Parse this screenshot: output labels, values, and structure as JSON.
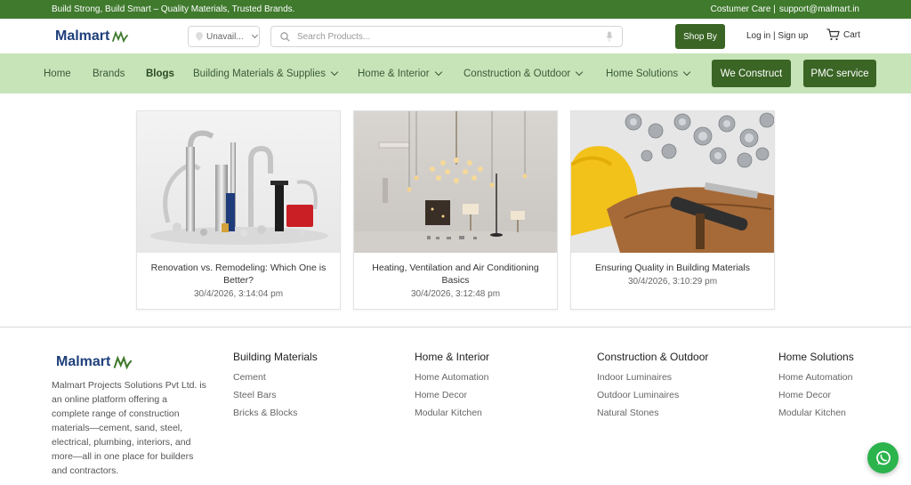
{
  "topbar": {
    "tagline": "Build Strong, Build Smart – Quality Materials, Trusted Brands.",
    "care_label": "Costumer Care |",
    "email": "support@malmart.in"
  },
  "header": {
    "logo_text": "Malmart",
    "location_value": "Unavail...",
    "search_placeholder": "Search Products...",
    "shopby_label": "Shop By",
    "auth_label": "Log in | Sign up",
    "cart_label": "Cart"
  },
  "nav": {
    "items": [
      {
        "label": "Home"
      },
      {
        "label": "Brands"
      },
      {
        "label": "Blogs"
      },
      {
        "label": "Building Materials & Supplies"
      },
      {
        "label": "Home & Interior"
      },
      {
        "label": "Construction & Outdoor"
      },
      {
        "label": "Home Solutions"
      }
    ],
    "buttons": [
      {
        "label": "We Construct"
      },
      {
        "label": "PMC service"
      }
    ]
  },
  "posts": [
    {
      "title": "Renovation vs. Remodeling: Which One is Better?",
      "date": "30/4/2026, 3:14:04 pm",
      "image": "plumbing-fixtures-image"
    },
    {
      "title": "Heating, Ventilation and Air Conditioning Basics",
      "date": "30/4/2026, 3:12:48 pm",
      "image": "lighting-fixtures-image"
    },
    {
      "title": "Ensuring Quality in Building Materials",
      "date": "30/4/2026, 3:10:29 pm",
      "image": "hardhat-pipe-fittings-image"
    }
  ],
  "footer": {
    "logo_text": "Malmart",
    "description": "Malmart Projects Solutions Pvt Ltd. is an online platform offering a complete range of construction materials—cement, sand, steel, electrical, plumbing, interiors, and more—all in one place for builders and contractors.",
    "columns": [
      {
        "heading": "Building Materials",
        "links": [
          "Cement",
          "Steel Bars",
          "Bricks & Blocks"
        ]
      },
      {
        "heading": "Home & Interior",
        "links": [
          "Home Automation",
          "Home Decor",
          "Modular Kitchen"
        ]
      },
      {
        "heading": "Construction & Outdoor",
        "links": [
          "Indoor Luminaires",
          "Outdoor Luminaires",
          "Natural Stones"
        ]
      },
      {
        "heading": "Home Solutions",
        "links": [
          "Home Automation",
          "Home Decor",
          "Modular Kitchen"
        ]
      }
    ]
  },
  "colors": {
    "brand_green": "#3f7a2d",
    "nav_bg": "#c7e4b8",
    "button_green": "#3a6525",
    "logo_blue": "#1e3f7a",
    "whatsapp_green": "#2bb34c"
  },
  "icons": [
    "location-pin-icon",
    "chevron-down-icon",
    "search-icon",
    "mic-icon",
    "cart-icon",
    "logo-swoosh-icon",
    "whatsapp-icon"
  ]
}
